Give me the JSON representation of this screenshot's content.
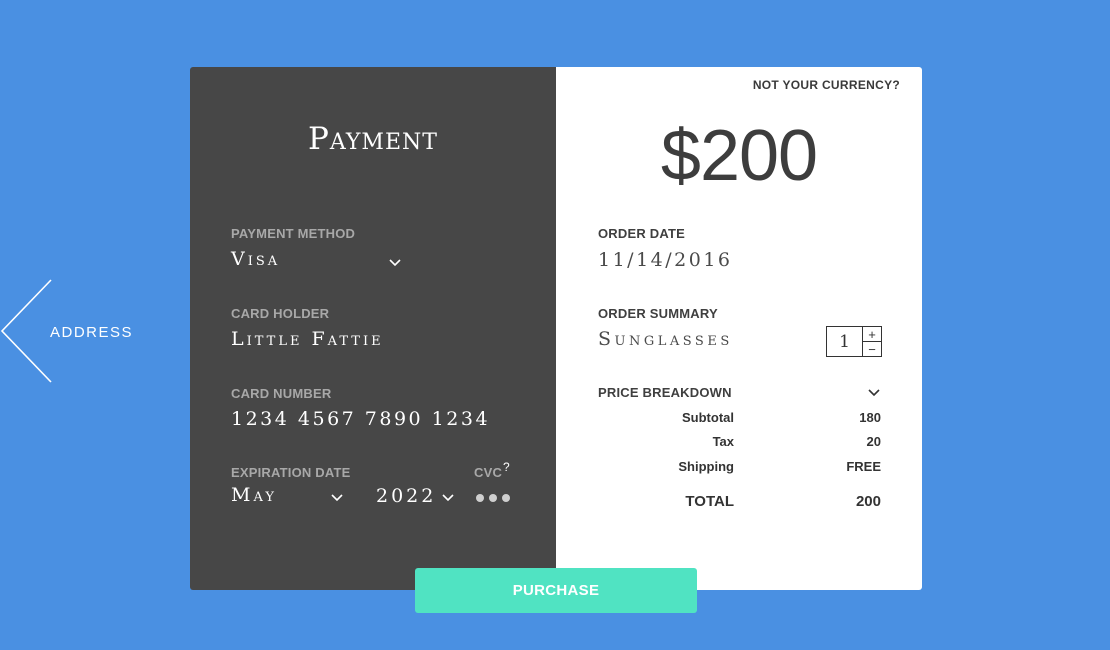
{
  "nav": {
    "back_label": "ADDRESS"
  },
  "payment": {
    "title": "Payment",
    "method_label": "PAYMENT METHOD",
    "method_value": "Visa",
    "holder_label": "CARD HOLDER",
    "holder_value": "Little Fattie",
    "number_label": "CARD NUMBER",
    "number_value": "1234 4567 7890 1234",
    "expiration_label": "EXPIRATION DATE",
    "expiration_month": "May",
    "expiration_year": "2022",
    "cvc_label": "CVC",
    "cvc_help": "?"
  },
  "order": {
    "currency_link": "NOT YOUR CURRENCY?",
    "amount": "$200",
    "date_label": "ORDER DATE",
    "date_value": "11/14/2016",
    "summary_label": "ORDER SUMMARY",
    "item_name": "Sunglasses",
    "quantity": "1",
    "qty_increment": "+",
    "qty_decrement": "−",
    "breakdown_label": "PRICE BREAKDOWN",
    "breakdown": [
      {
        "label": "Subtotal",
        "value": "180"
      },
      {
        "label": "Tax",
        "value": "20"
      },
      {
        "label": "Shipping",
        "value": "FREE"
      }
    ],
    "total_label": "TOTAL",
    "total_value": "200"
  },
  "actions": {
    "purchase_label": "PURCHASE"
  },
  "colors": {
    "background": "#4a90e2",
    "panel_dark": "#474747",
    "panel_light": "#ffffff",
    "accent": "#50e3c2"
  },
  "icons": {
    "back": "chevron-left-icon",
    "dropdown": "chevron-down-icon",
    "help": "question-icon"
  }
}
